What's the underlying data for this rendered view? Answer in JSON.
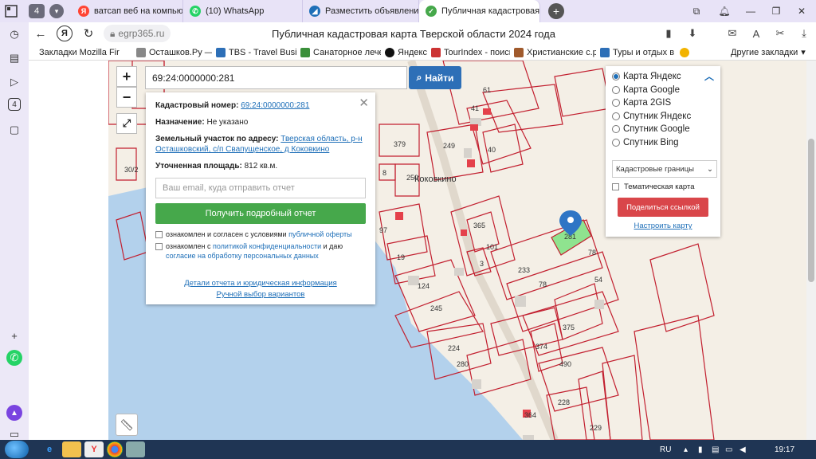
{
  "browser": {
    "tab_count": "4",
    "tabs": [
      {
        "label": "ватсап веб на компьютере",
        "icon": "yandex-icon",
        "color": "#ff4433"
      },
      {
        "label": "(10) WhatsApp",
        "icon": "whatsapp-icon",
        "color": "#25d366"
      },
      {
        "label": "Разместить объявление о",
        "icon": "avito-icon",
        "color": "#1e6fb8"
      },
      {
        "label": "Публичная кадастровая",
        "icon": "check-icon",
        "color": "#46a84b"
      }
    ],
    "url": "egrp365.ru",
    "page_title": "Публичная кадастровая карта Тверской области 2024 года",
    "bookmarks": [
      {
        "label": "Закладки Mozilla Fir",
        "color": "#555"
      },
      {
        "label": "Осташков.Ру — о",
        "color": "#888"
      },
      {
        "label": "TBS - Travel Busin",
        "color": "#2d6fb7"
      },
      {
        "label": "Санаторное лечен",
        "color": "#3a8f3a"
      },
      {
        "label": "Яндекс",
        "color": "#111"
      },
      {
        "label": "TourIndex - поиск",
        "color": "#c33"
      },
      {
        "label": "Христианские с.р",
        "color": "#a05a2c"
      },
      {
        "label": "Туры и отдых в Т",
        "color": "#2d6fb7"
      },
      {
        "label": "",
        "color": "#f2b300"
      }
    ],
    "other_bookmarks": "Другие закладки"
  },
  "map": {
    "search_value": "69:24:0000000:281",
    "find_button": "Найти",
    "zoom_in": "+",
    "zoom_out": "−",
    "town_name": "Коковкино",
    "parcels": [
      "61",
      "41",
      "249",
      "40",
      "379",
      "8",
      "250",
      "97",
      "365",
      "101",
      "3",
      "19",
      "124",
      "233",
      "78",
      "54",
      "245",
      "375",
      "374",
      "224",
      "280",
      "490",
      "228",
      "229",
      "78",
      "30/2",
      "364"
    ],
    "highlighted_parcel": "281"
  },
  "info": {
    "cadastral_label": "Кадастровый номер:",
    "cadastral_value": "69:24:0000000:281",
    "purpose_label": "Назначение:",
    "purpose_value": "Не указано",
    "address_label": "Земельный участок по адресу:",
    "address_value": "Тверская область, р-н Осташковский, с/п Свапущенское, д Коковкино",
    "area_label": "Уточненная площадь:",
    "area_value": "812 кв.м.",
    "email_placeholder": "Ваш email, куда отправить отчет",
    "report_button": "Получить подробный отчет",
    "consent1_prefix": "ознакомлен и согласен с условиями",
    "consent1_link": "публичной оферты",
    "consent2_prefix": "ознакомлен с",
    "consent2_link1": "политикой конфиденциальности",
    "consent2_mid": "и даю",
    "consent2_link2": "согласие на обработку персональных данных",
    "details_link": "Детали отчета и юридическая информация",
    "manual_link": "Ручной выбор вариантов"
  },
  "layers": {
    "options": [
      "Карта Яндекс",
      "Карта Google",
      "Карта 2GIS",
      "Спутник Яндекс",
      "Спутник Google",
      "Спутник Bing"
    ],
    "selected": 0,
    "boundary_select": "Кадастровые границы",
    "thematic_label": "Тематическая карта",
    "share_button": "Поделиться ссылкой",
    "configure_link": "Настроить карту"
  },
  "taskbar": {
    "lang": "RU",
    "time": "19:17"
  }
}
